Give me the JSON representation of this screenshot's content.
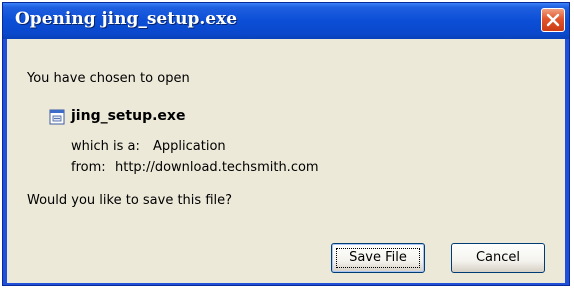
{
  "window": {
    "title": "Opening jing_setup.exe"
  },
  "dialog": {
    "intro": "You have chosen to open",
    "file_name": "jing_setup.exe",
    "type_label": "which is a:",
    "type_value": "Application",
    "from_label": "from:",
    "from_value": "http://download.techsmith.com",
    "question": "Would you like to save this file?"
  },
  "buttons": {
    "save_label": "Save File",
    "cancel_label": "Cancel"
  },
  "icons": {
    "close": "close-icon",
    "file": "application-file-icon"
  },
  "colors": {
    "titlebar": "#0b4ed6",
    "client_bg": "#ece9d8",
    "close_button": "#e2552c"
  }
}
